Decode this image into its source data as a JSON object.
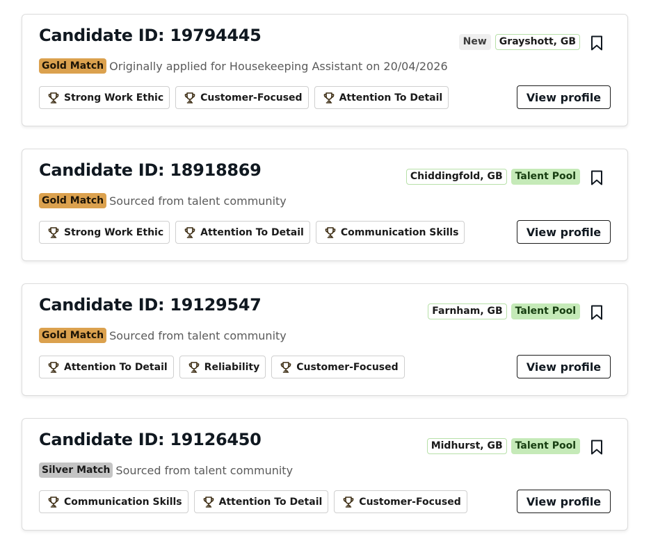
{
  "candidates": [
    {
      "title": "Candidate ID: 19794445",
      "tags": [
        {
          "label": "New",
          "type": "new"
        },
        {
          "label": "Grayshott, GB",
          "type": "loc"
        }
      ],
      "match": "Gold Match",
      "match_type": "gold",
      "subtext": "Originally applied for Housekeeping Assistant on 20/04/2026",
      "skills": [
        "Strong Work Ethic",
        "Customer-Focused",
        "Attention To Detail"
      ],
      "button": "View profile"
    },
    {
      "title": "Candidate ID: 18918869",
      "tags": [
        {
          "label": "Chiddingfold, GB",
          "type": "loc"
        },
        {
          "label": "Talent Pool",
          "type": "pool"
        }
      ],
      "match": "Gold Match",
      "match_type": "gold",
      "subtext": "Sourced from talent community",
      "skills": [
        "Strong Work Ethic",
        "Attention To Detail",
        "Communication Skills"
      ],
      "button": "View profile"
    },
    {
      "title": "Candidate ID: 19129547",
      "tags": [
        {
          "label": "Farnham, GB",
          "type": "loc"
        },
        {
          "label": "Talent Pool",
          "type": "pool"
        }
      ],
      "match": "Gold Match",
      "match_type": "gold",
      "subtext": "Sourced from talent community",
      "skills": [
        "Attention To Detail",
        "Reliability",
        "Customer-Focused"
      ],
      "button": "View profile"
    },
    {
      "title": "Candidate ID: 19126450",
      "tags": [
        {
          "label": "Midhurst, GB",
          "type": "loc"
        },
        {
          "label": "Talent Pool",
          "type": "pool"
        }
      ],
      "match": "Silver Match",
      "match_type": "silver",
      "subtext": "Sourced from talent community",
      "skills": [
        "Communication Skills",
        "Attention To Detail",
        "Customer-Focused"
      ],
      "button": "View profile"
    }
  ],
  "icons": {
    "skill": "trophy-icon",
    "save": "bookmark-icon"
  }
}
